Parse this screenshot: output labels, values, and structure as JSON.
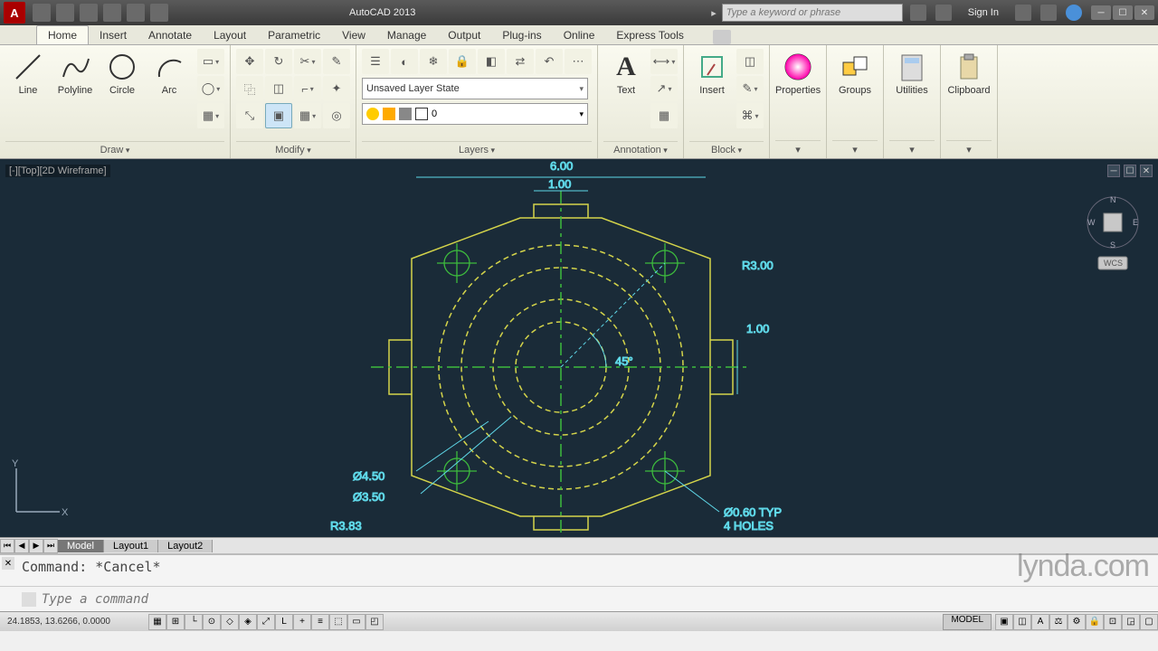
{
  "app": {
    "title": "AutoCAD 2013",
    "search_placeholder": "Type a keyword or phrase",
    "signin": "Sign In"
  },
  "tabs": [
    "Home",
    "Insert",
    "Annotate",
    "Layout",
    "Parametric",
    "View",
    "Manage",
    "Output",
    "Plug-ins",
    "Online",
    "Express Tools"
  ],
  "active_tab": 0,
  "ribbon": {
    "draw": {
      "title": "Draw",
      "line": "Line",
      "polyline": "Polyline",
      "circle": "Circle",
      "arc": "Arc"
    },
    "modify": {
      "title": "Modify"
    },
    "layers": {
      "title": "Layers",
      "state": "Unsaved Layer State",
      "current": "0"
    },
    "annotation": {
      "title": "Annotation",
      "text": "Text"
    },
    "block": {
      "title": "Block",
      "insert": "Insert"
    },
    "properties": {
      "title": "Properties"
    },
    "groups": {
      "title": "Groups"
    },
    "utilities": {
      "title": "Utilities"
    },
    "clipboard": {
      "title": "Clipboard"
    }
  },
  "viewport": {
    "label": "[-][Top][2D Wireframe]",
    "wcs": "WCS"
  },
  "dims": {
    "width": "6.00",
    "gap": "1.00",
    "rad": "R3.00",
    "height": "1.00",
    "ang": "45°",
    "d1": "Ø4.50",
    "d2": "Ø3.50",
    "r2": "R3.83",
    "hole": "Ø0.60 TYP",
    "holes": "4 HOLES"
  },
  "model_tabs": [
    "Model",
    "Layout1",
    "Layout2"
  ],
  "active_model_tab": 0,
  "command": {
    "history": "Command: *Cancel*",
    "placeholder": "Type a command"
  },
  "status": {
    "coords": "24.1853, 13.6266, 0.0000",
    "mode": "MODEL"
  },
  "watermark": "lynda.com",
  "nav": {
    "n": "N",
    "s": "S",
    "e": "E",
    "w": "W"
  }
}
